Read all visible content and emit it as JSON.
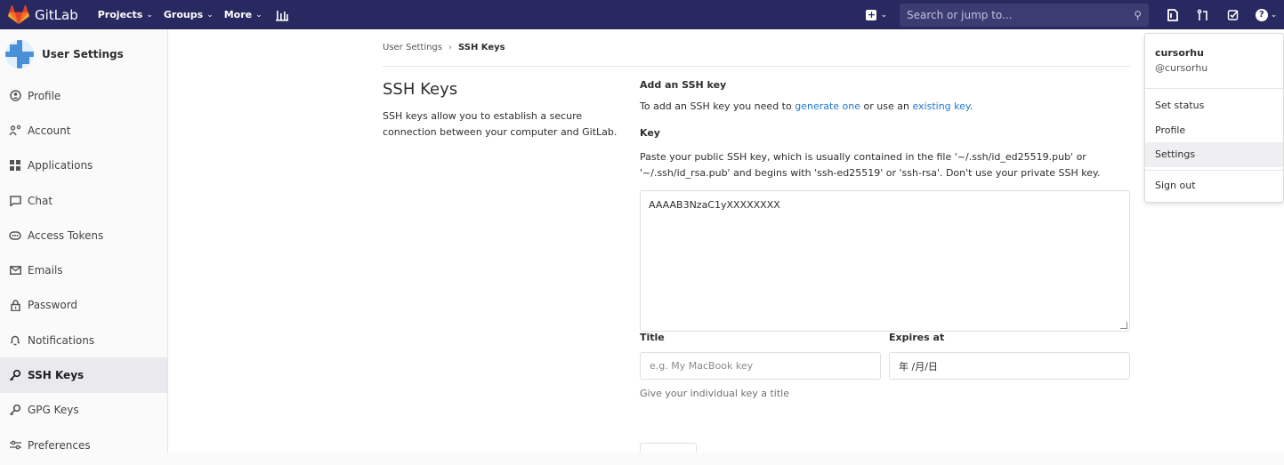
{
  "navbar": {
    "brand": "GitLab",
    "menu": [
      {
        "label": "Projects"
      },
      {
        "label": "Groups"
      },
      {
        "label": "More"
      }
    ],
    "search_placeholder": "Search or jump to...",
    "colors": {
      "background": "#292961",
      "search": "#3c3c73"
    }
  },
  "sidebar": {
    "title": "User Settings",
    "items": [
      {
        "label": "Profile",
        "icon": "profile-icon"
      },
      {
        "label": "Account",
        "icon": "account-icon"
      },
      {
        "label": "Applications",
        "icon": "applications-icon"
      },
      {
        "label": "Chat",
        "icon": "chat-icon"
      },
      {
        "label": "Access Tokens",
        "icon": "token-icon"
      },
      {
        "label": "Emails",
        "icon": "email-icon"
      },
      {
        "label": "Password",
        "icon": "lock-icon"
      },
      {
        "label": "Notifications",
        "icon": "bell-icon"
      },
      {
        "label": "SSH Keys",
        "icon": "key-icon",
        "active": true
      },
      {
        "label": "GPG Keys",
        "icon": "key-icon"
      },
      {
        "label": "Preferences",
        "icon": "preferences-icon"
      }
    ]
  },
  "breadcrumb": {
    "parent": "User Settings",
    "separator": "›",
    "current": "SSH Keys"
  },
  "section": {
    "title": "SSH Keys",
    "description": "SSH keys allow you to establish a secure connection between your computer and GitLab."
  },
  "form": {
    "add_heading": "Add an SSH key",
    "add_text_prefix": "To add an SSH key you need to ",
    "generate_link": "generate one",
    "add_text_middle": " or use an ",
    "existing_link": "existing key",
    "add_text_suffix": ".",
    "key_label": "Key",
    "key_help": "Paste your public SSH key, which is usually contained in the file '~/.ssh/id_ed25519.pub' or '~/.ssh/id_rsa.pub' and begins with 'ssh-ed25519' or 'ssh-rsa'. Don't use your private SSH key.",
    "key_value": "AAAAB3NzaC1yXXXXXXXX",
    "title_label": "Title",
    "title_placeholder": "e.g. My MacBook key",
    "title_hint": "Give your individual key a title",
    "expires_label": "Expires at",
    "expires_value": "年 /月/日"
  },
  "user_dropdown": {
    "name": "cursorhu",
    "handle": "@cursorhu",
    "items_group1": [
      "Set status",
      "Profile",
      "Settings"
    ],
    "highlighted": "Settings",
    "items_group2": [
      "Sign out"
    ]
  },
  "accent_color": "#1f78d1"
}
